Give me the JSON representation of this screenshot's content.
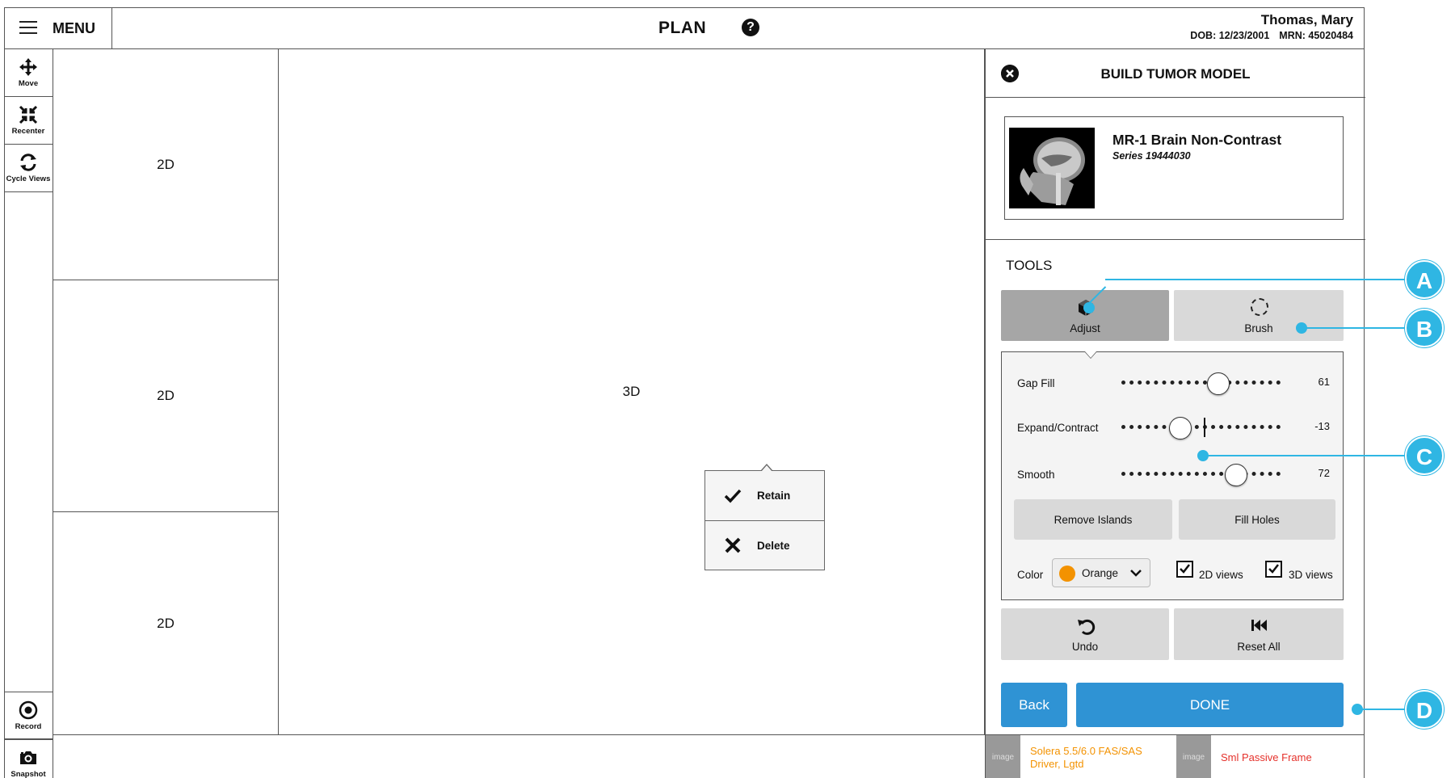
{
  "header": {
    "menu_label": "MENU",
    "title": "PLAN",
    "patient_name": "Thomas, Mary",
    "dob": "DOB: 12/23/2001",
    "mrn": "MRN: 45020484"
  },
  "toolbar": {
    "move": "Move",
    "recenter": "Recenter",
    "cycle_views": "Cycle Views",
    "record": "Record",
    "snapshot": "Snapshot"
  },
  "viewports": {
    "top": "2D",
    "middle": "2D",
    "bottom": "2D",
    "main": "3D"
  },
  "popup": {
    "retain": "Retain",
    "delete": "Delete"
  },
  "panel": {
    "title": "BUILD TUMOR MODEL",
    "series_name": "MR-1 Brain Non-Contrast",
    "series_id": "Series 19444030",
    "tools_label": "TOOLS",
    "adjust_label": "Adjust",
    "brush_label": "Brush",
    "sliders": [
      {
        "label": "Gap Fill",
        "value": "61",
        "level": 0.61
      },
      {
        "label": "Expand/Contract",
        "value": "-13",
        "level": 0.37
      },
      {
        "label": "Smooth",
        "value": "72",
        "level": 0.72
      }
    ],
    "remove_islands": "Remove Islands",
    "fill_holes": "Fill Holes",
    "color_label": "Color",
    "color_value": "Orange",
    "color_hex": "#f39200",
    "check_2d": "2D views",
    "check_3d": "3D views",
    "undo": "Undo",
    "reset_all": "Reset All",
    "back": "Back",
    "done": "DONE"
  },
  "status_bar": {
    "image_placeholder": "image",
    "item1": "Solera 5.5/6.0 FAS/SAS Driver, Lgtd",
    "item1_color": "#f39200",
    "item2": "Sml Passive Frame",
    "item2_color": "#e5312b"
  },
  "callouts": [
    "A",
    "B",
    "C",
    "D"
  ]
}
